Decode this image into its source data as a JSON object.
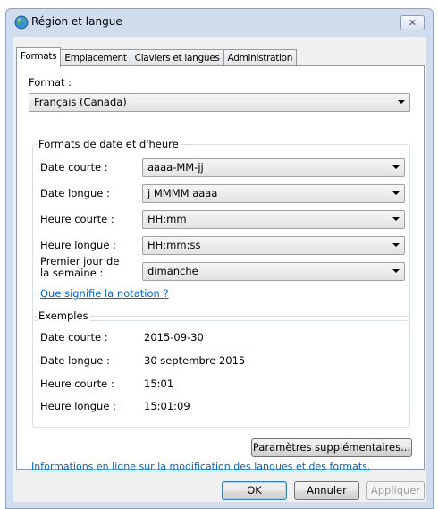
{
  "window": {
    "title": "Région et langue",
    "close_label": "✕"
  },
  "tabs": [
    {
      "label": "Formats",
      "active": true
    },
    {
      "label": "Emplacement",
      "active": false
    },
    {
      "label": "Claviers et langues",
      "active": false
    },
    {
      "label": "Administration",
      "active": false
    }
  ],
  "format": {
    "label": "Format :",
    "value": "Français (Canada)"
  },
  "datetime_group": {
    "title": "Formats de date et d'heure",
    "rows": [
      {
        "label": "Date courte :",
        "value": "aaaa-MM-jj"
      },
      {
        "label": "Date longue :",
        "value": "j MMMM aaaa"
      },
      {
        "label": "Heure courte :",
        "value": "HH:mm"
      },
      {
        "label": "Heure longue :",
        "value": "HH:mm:ss"
      },
      {
        "label_line1": "Premier jour de",
        "label_line2": "la semaine :",
        "value": "dimanche"
      }
    ],
    "notation_link": "Que signifie la notation ?"
  },
  "examples_group": {
    "title": "Exemples",
    "rows": [
      {
        "label": "Date courte :",
        "value": "2015-09-30"
      },
      {
        "label": "Date longue :",
        "value": "30 septembre 2015"
      },
      {
        "label": "Heure courte :",
        "value": "15:01"
      },
      {
        "label": "Heure longue :",
        "value": "15:01:09"
      }
    ]
  },
  "additional_settings_button": "Paramètres supplémentaires...",
  "online_info_link": "Informations en ligne sur la modification des langues et des formats.",
  "footer": {
    "ok": "OK",
    "cancel": "Annuler",
    "apply": "Appliquer"
  },
  "colors": {
    "link": "#0066cc",
    "window_frame": "#cfddee",
    "panel": "#ffffff"
  }
}
